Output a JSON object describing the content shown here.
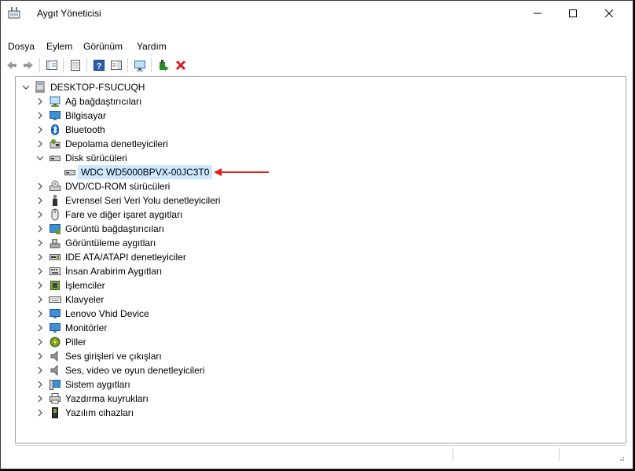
{
  "window": {
    "title": "Aygıt Yöneticisi"
  },
  "menu": [
    "Dosya",
    "Eylem",
    "Görünüm",
    "Yardım"
  ],
  "toolbar": [
    "back-icon",
    "forward-icon",
    "properties-pane-icon",
    "show-hidden-icon",
    "help-icon",
    "view-icon",
    "scan-hardware-icon",
    "update-driver-icon",
    "uninstall-icon"
  ],
  "tree": {
    "root": "DESKTOP-FSUCUQH",
    "categories": [
      "Ağ bağdaştırıcıları",
      "Bilgisayar",
      "Bluetooth",
      "Depolama denetleyicileri",
      "Disk sürücüleri",
      "DVD/CD-ROM sürücüleri",
      "Evrensel Seri Veri Yolu denetleyicileri",
      "Fare ve diğer işaret aygıtları",
      "Görüntü bağdaştırıcıları",
      "Görüntüleme aygıtları",
      "IDE ATA/ATAPI denetleyiciler",
      "İnsan Arabirim Aygıtları",
      "İşlemciler",
      "Klavyeler",
      "Lenovo Vhid Device",
      "Monitörler",
      "Piller",
      "Ses girişleri ve çıkışları",
      "Ses, video ve oyun denetleyicileri",
      "Sistem aygıtları",
      "Yazdırma kuyrukları",
      "Yazılım cihazları"
    ],
    "disk_child": "WDC WD5000BPVX-00JC3T0"
  },
  "colors": {
    "annotation_arrow": "#e02020",
    "selection": "#cce8ff",
    "close_x": "#d42020"
  }
}
